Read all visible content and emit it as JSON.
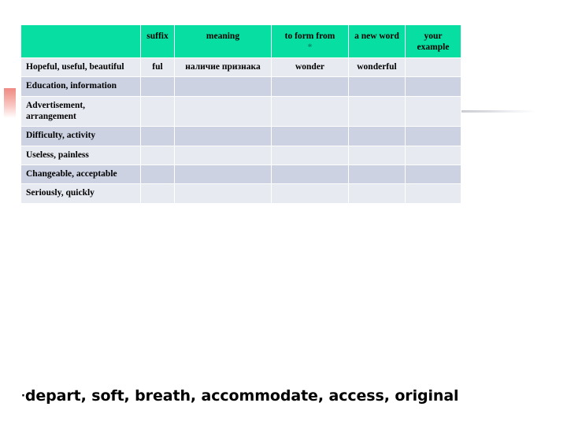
{
  "slide": {
    "bottom_note": {
      "bullet": "·",
      "text": "depart, soft, breath, accommodate, access, original"
    }
  },
  "table": {
    "headers": [
      {
        "label": "",
        "key": "term"
      },
      {
        "label": "suffix",
        "key": "suffix"
      },
      {
        "label": "meaning",
        "key": "meaning"
      },
      {
        "label": "to form from",
        "key": "form",
        "asterisk": "*"
      },
      {
        "label": "a new word",
        "key": "newword"
      },
      {
        "label": "your example",
        "key": "example"
      }
    ],
    "rows": [
      {
        "term": "Hopeful, useful, beautiful",
        "suffix": "ful",
        "meaning": "наличие признака",
        "form": "wonder",
        "newword": "wonderful",
        "example": ""
      },
      {
        "term": "Education, information",
        "suffix": "",
        "meaning": "",
        "form": "",
        "newword": "",
        "example": ""
      },
      {
        "term": "Advertisement, arrangement",
        "suffix": "",
        "meaning": "",
        "form": "",
        "newword": "",
        "example": ""
      },
      {
        "term": "Difficulty, activity",
        "suffix": "",
        "meaning": "",
        "form": "",
        "newword": "",
        "example": ""
      },
      {
        "term": "Useless, painless",
        "suffix": "",
        "meaning": "",
        "form": "",
        "newword": "",
        "example": ""
      },
      {
        "term": "Changeable, acceptable",
        "suffix": "",
        "meaning": "",
        "form": "",
        "newword": "",
        "example": ""
      },
      {
        "term": "Seriously, quickly",
        "suffix": "",
        "meaning": "",
        "form": "",
        "newword": "",
        "example": ""
      }
    ]
  },
  "colors": {
    "header_green": "#07dea2",
    "row_light": "#e7eaf1",
    "row_dark": "#ccd2e2",
    "marker_red": "#f08a84"
  }
}
